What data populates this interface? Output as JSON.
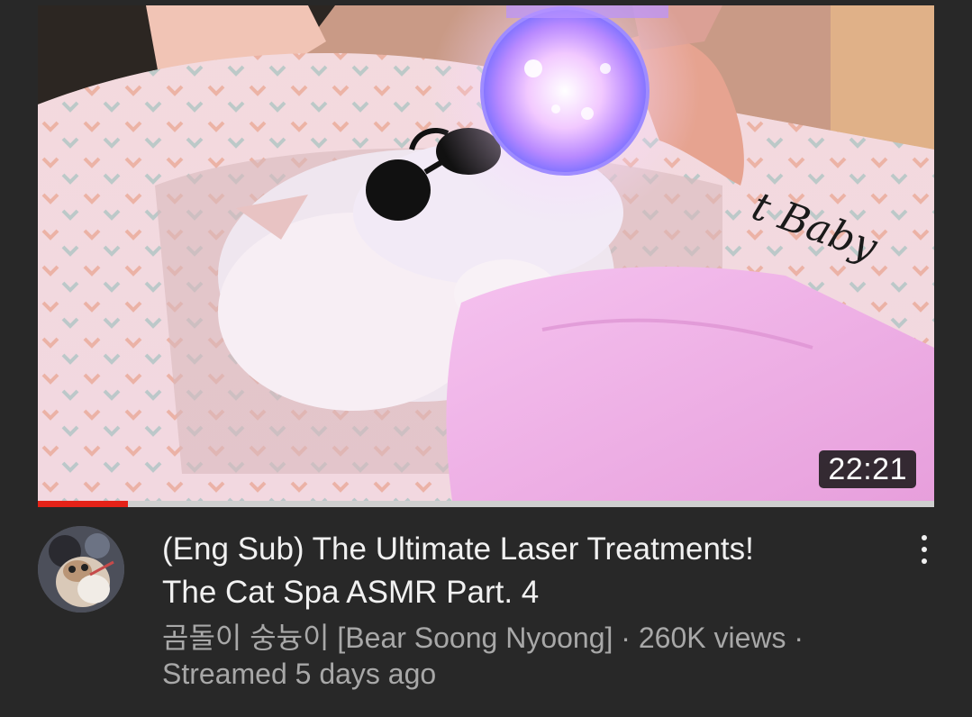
{
  "video": {
    "title_line1": "(Eng Sub) The Ultimate Laser Treatments!",
    "title_line2": "The Cat Spa ASMR Part. 4",
    "duration": "22:21",
    "watch_progress_fraction": 0.1,
    "channel": "곰돌이 숭늉이 [Bear Soong Nyoong]",
    "separator": "·",
    "views": "260K views",
    "streamed": "Streamed 5 days ago",
    "thumbnail_text": "t Baby"
  },
  "colors": {
    "background": "#282828",
    "title_text": "#f1f1f1",
    "secondary_text": "#a8a8a8",
    "progress_fill": "#e52218",
    "progress_track": "#cfcfcf"
  },
  "icons": {
    "more": "kebab-vertical-dots"
  }
}
